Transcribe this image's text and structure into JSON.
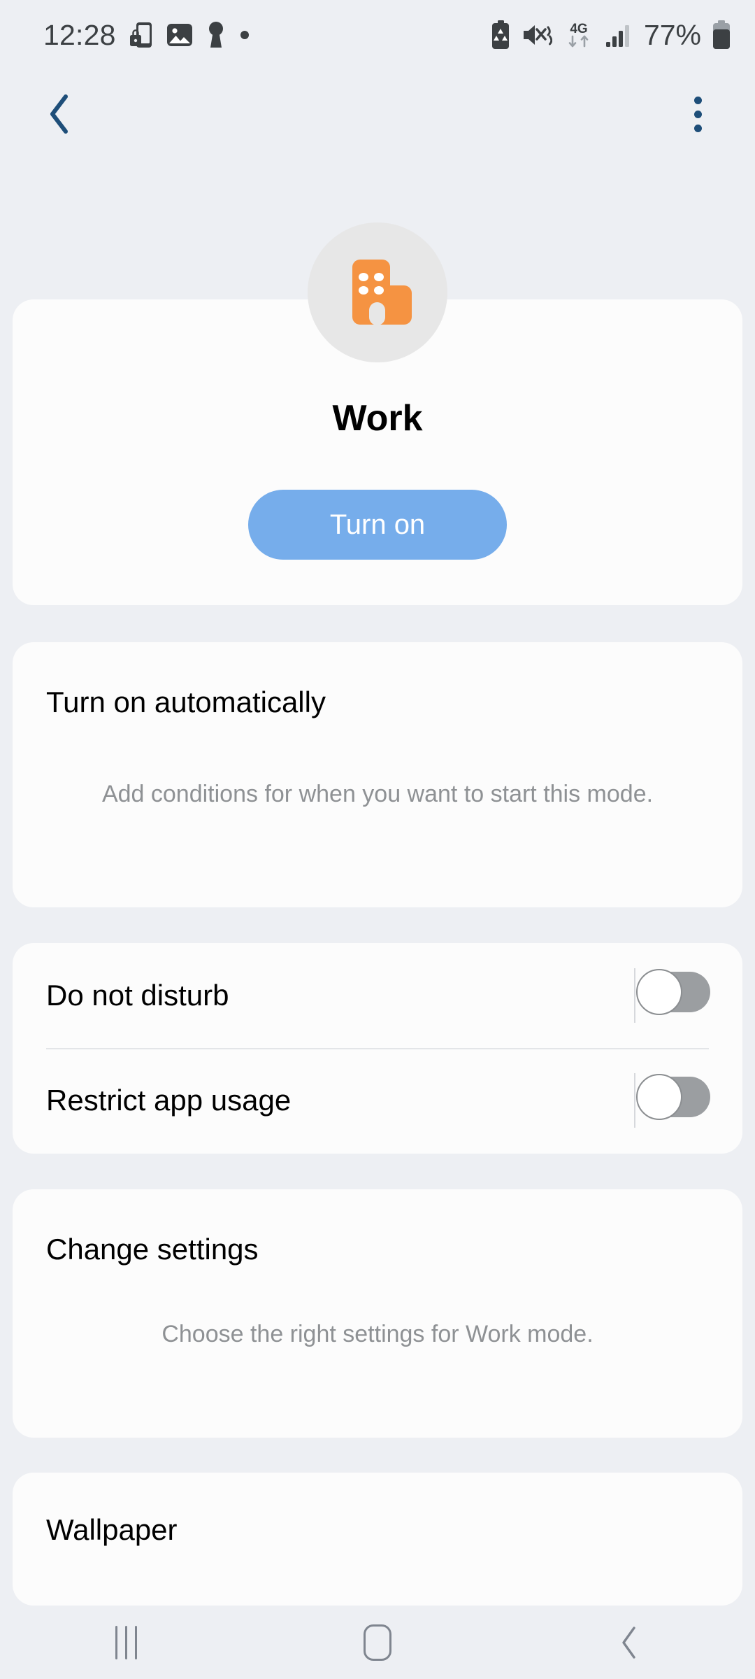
{
  "status_bar": {
    "time": "12:28",
    "battery_percent": "77%",
    "network_type": "4G",
    "left_icons": [
      "phone-lock-icon",
      "gallery-image-icon",
      "keyhole-lock-icon",
      "dot-indicator-icon"
    ],
    "right_icons": [
      "battery-saver-icon",
      "mute-vibrate-icon",
      "4g-data-icon",
      "signal-bars-icon",
      "battery-icon"
    ]
  },
  "app_bar": {
    "back_label": "Back",
    "more_label": "More options"
  },
  "hero": {
    "mode_icon": "work-building-icon",
    "mode_name": "Work",
    "action_label": "Turn on"
  },
  "sections": {
    "auto": {
      "title": "Turn on automatically",
      "description": "Add conditions for when you want to start this mode."
    },
    "toggles": [
      {
        "label": "Do not disturb",
        "state": "off"
      },
      {
        "label": "Restrict app usage",
        "state": "off"
      }
    ],
    "change_settings": {
      "title": "Change settings",
      "description": "Choose the right settings for Work mode."
    },
    "wallpaper": {
      "title": "Wallpaper"
    }
  },
  "nav_bar": {
    "recents_label": "Recents",
    "home_label": "Home",
    "back_label": "Back"
  },
  "colors": {
    "background": "#edeff3",
    "card": "#fcfcfc",
    "accent_blue": "#76adeb",
    "header_icon": "#1e4e79",
    "mode_icon_orange": "#f59342",
    "mode_icon_circle": "#e7e7e7",
    "secondary_text": "#8e9194",
    "toggle_off_track": "#9b9ea1",
    "nav_icon": "#7f858f"
  }
}
